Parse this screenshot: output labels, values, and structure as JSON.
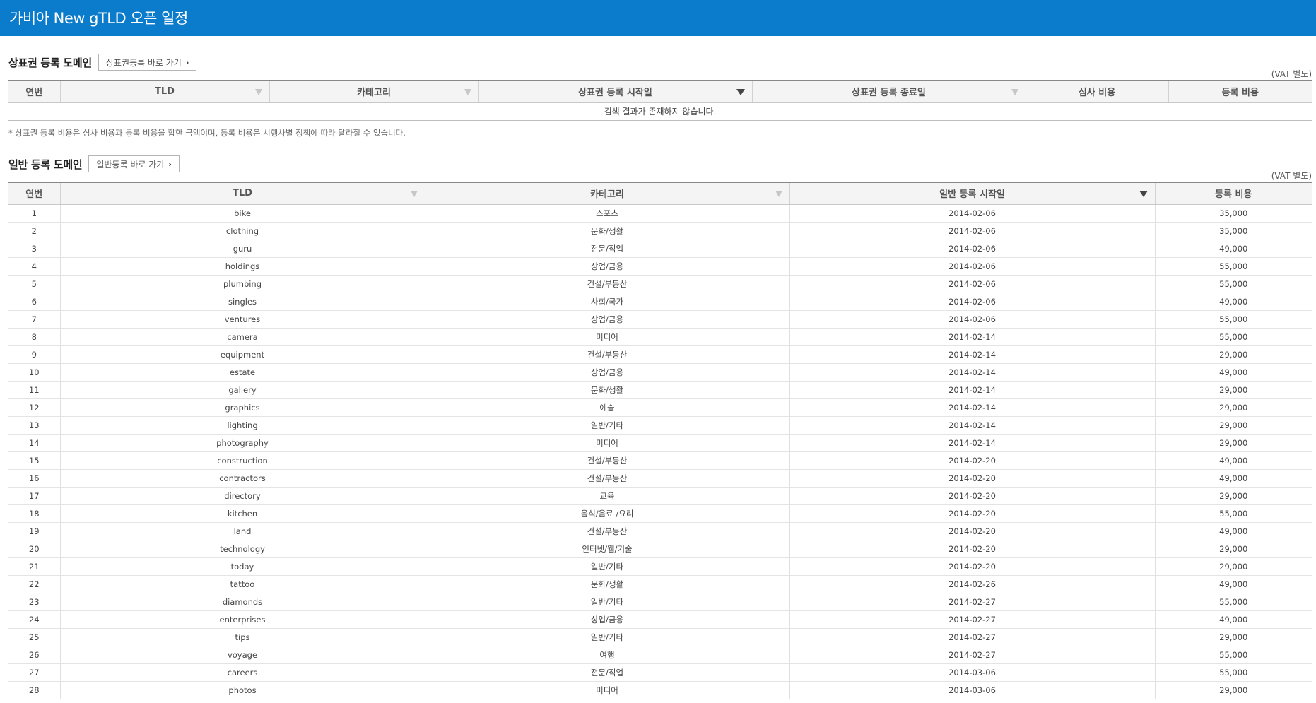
{
  "header": {
    "title": "가비아 New gTLD 오픈 일정"
  },
  "trademark": {
    "title": "상표권 등록 도메인",
    "button_label": "상표권등록 바로 가기",
    "vat_note": "(VAT 별도)",
    "columns": {
      "no": "연번",
      "tld": "TLD",
      "category": "카테고리",
      "start": "상표권 등록 시작일",
      "end": "상표권 등록 종료일",
      "review_fee": "심사 비용",
      "reg_fee": "등록 비용"
    },
    "empty_message": "검색 결과가 존재하지 않습니다.",
    "footnote": "* 상표권 등록 비용은 심사 비용과 등록 비용을 합한 금액이며, 등록 비용은 시행사별 정책에 따라 달라질 수 있습니다."
  },
  "general": {
    "title": "일반 등록 도메인",
    "button_label": "일반등록 바로 가기",
    "vat_note": "(VAT 별도)",
    "columns": {
      "no": "연번",
      "tld": "TLD",
      "category": "카테고리",
      "start": "일반 등록 시작일",
      "reg_fee": "등록 비용"
    },
    "rows": [
      [
        "1",
        "bike",
        "스포츠",
        "2014-02-06",
        "35,000"
      ],
      [
        "2",
        "clothing",
        "문화/생활",
        "2014-02-06",
        "35,000"
      ],
      [
        "3",
        "guru",
        "전문/직업",
        "2014-02-06",
        "49,000"
      ],
      [
        "4",
        "holdings",
        "상업/금융",
        "2014-02-06",
        "55,000"
      ],
      [
        "5",
        "plumbing",
        "건설/부동산",
        "2014-02-06",
        "55,000"
      ],
      [
        "6",
        "singles",
        "사회/국가",
        "2014-02-06",
        "49,000"
      ],
      [
        "7",
        "ventures",
        "상업/금융",
        "2014-02-06",
        "55,000"
      ],
      [
        "8",
        "camera",
        "미디어",
        "2014-02-14",
        "55,000"
      ],
      [
        "9",
        "equipment",
        "건설/부동산",
        "2014-02-14",
        "29,000"
      ],
      [
        "10",
        "estate",
        "상업/금융",
        "2014-02-14",
        "49,000"
      ],
      [
        "11",
        "gallery",
        "문화/생활",
        "2014-02-14",
        "29,000"
      ],
      [
        "12",
        "graphics",
        "예술",
        "2014-02-14",
        "29,000"
      ],
      [
        "13",
        "lighting",
        "일반/기타",
        "2014-02-14",
        "29,000"
      ],
      [
        "14",
        "photography",
        "미디어",
        "2014-02-14",
        "29,000"
      ],
      [
        "15",
        "construction",
        "건설/부동산",
        "2014-02-20",
        "49,000"
      ],
      [
        "16",
        "contractors",
        "건설/부동산",
        "2014-02-20",
        "49,000"
      ],
      [
        "17",
        "directory",
        "교육",
        "2014-02-20",
        "29,000"
      ],
      [
        "18",
        "kitchen",
        "음식/음료 /요리",
        "2014-02-20",
        "55,000"
      ],
      [
        "19",
        "land",
        "건설/부동산",
        "2014-02-20",
        "49,000"
      ],
      [
        "20",
        "technology",
        "인터넷/웹/기술",
        "2014-02-20",
        "29,000"
      ],
      [
        "21",
        "today",
        "일반/기타",
        "2014-02-20",
        "29,000"
      ],
      [
        "22",
        "tattoo",
        "문화/생활",
        "2014-02-26",
        "49,000"
      ],
      [
        "23",
        "diamonds",
        "일반/기타",
        "2014-02-27",
        "55,000"
      ],
      [
        "24",
        "enterprises",
        "상업/금융",
        "2014-02-27",
        "49,000"
      ],
      [
        "25",
        "tips",
        "일반/기타",
        "2014-02-27",
        "29,000"
      ],
      [
        "26",
        "voyage",
        "여행",
        "2014-02-27",
        "55,000"
      ],
      [
        "27",
        "careers",
        "전문/직업",
        "2014-03-06",
        "55,000"
      ],
      [
        "28",
        "photos",
        "미디어",
        "2014-03-06",
        "29,000"
      ]
    ]
  }
}
